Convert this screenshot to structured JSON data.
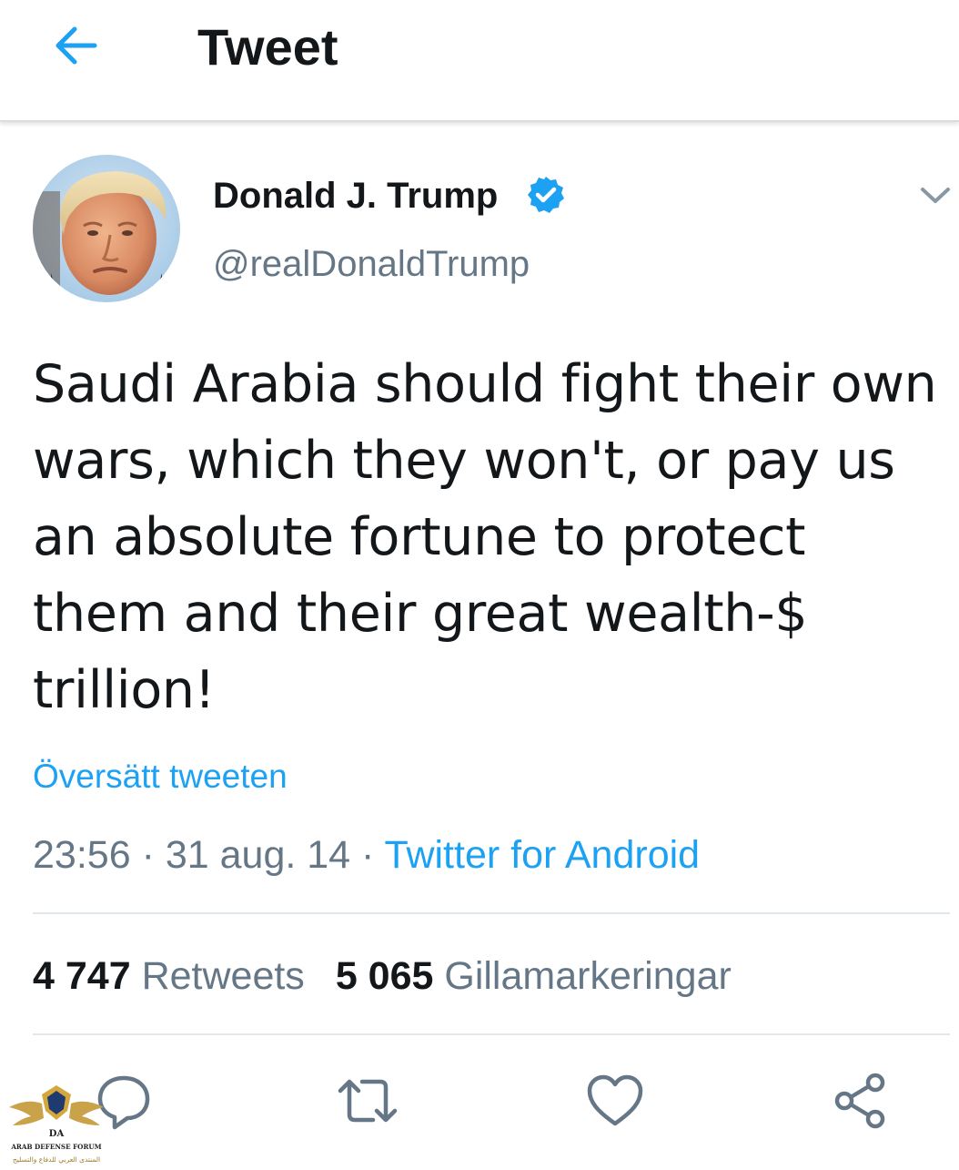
{
  "header": {
    "title": "Tweet",
    "back_icon": "back-arrow-icon"
  },
  "tweet": {
    "author": {
      "name": "Donald J. Trump",
      "handle": "@realDonaldTrump",
      "verified": true
    },
    "text": "Saudi Arabia should fight their own wars, which they won't, or pay us an absolute fortune to protect them and their great wealth-$ trillion!",
    "translate_label": "Översätt tweeten",
    "time": "23:56",
    "separator": "·",
    "date": "31 aug. 14",
    "source": "Twitter for Android"
  },
  "stats": {
    "retweets_count": "4 747",
    "retweets_label": "Retweets",
    "likes_count": "5 065",
    "likes_label": "Gillamarkeringar"
  },
  "actions": [
    {
      "name": "reply",
      "icon": "reply-icon"
    },
    {
      "name": "retweet",
      "icon": "retweet-icon"
    },
    {
      "name": "like",
      "icon": "heart-icon"
    },
    {
      "name": "share",
      "icon": "share-icon"
    }
  ],
  "watermark": {
    "text_en": "ARAB DEFENSE FORUM",
    "text_ar": "المنتدى العربي للدفاع والتسليح",
    "monogram": "DA"
  },
  "colors": {
    "accent": "#1da1f2",
    "text_primary": "#14171a",
    "text_secondary": "#657786",
    "divider": "#e1e8ed",
    "verified": "#1da1f2"
  }
}
